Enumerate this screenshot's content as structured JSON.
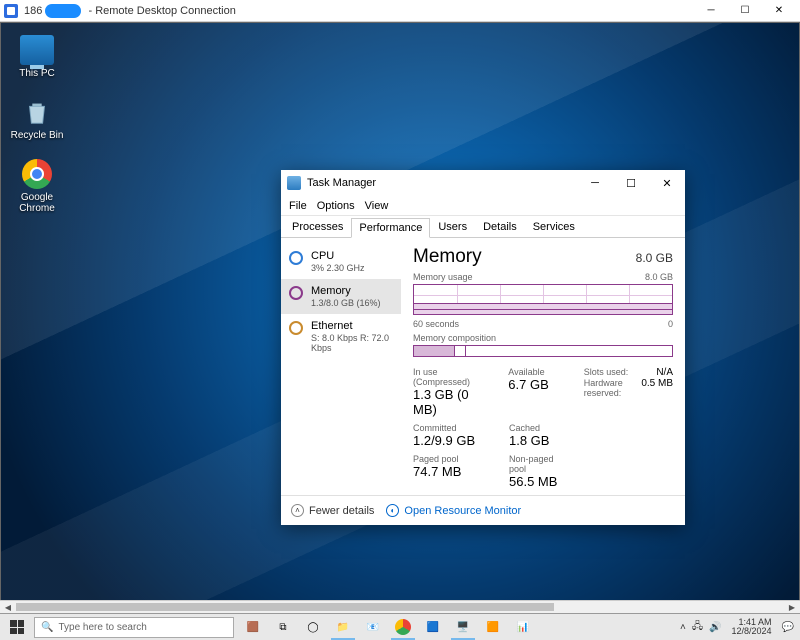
{
  "rdc": {
    "title_prefix": "186",
    "title_suffix": "- Remote Desktop Connection"
  },
  "desktop": {
    "this_pc": "This PC",
    "recycle": "Recycle Bin",
    "chrome": "Google Chrome"
  },
  "taskmgr": {
    "title": "Task Manager",
    "menu": {
      "file": "File",
      "options": "Options",
      "view": "View"
    },
    "tabs": {
      "processes": "Processes",
      "performance": "Performance",
      "users": "Users",
      "details": "Details",
      "services": "Services"
    },
    "side": {
      "cpu": {
        "name": "CPU",
        "sub": "3% 2.30 GHz"
      },
      "memory": {
        "name": "Memory",
        "sub": "1.3/8.0 GB (16%)"
      },
      "ethernet": {
        "name": "Ethernet",
        "sub": "S: 8.0 Kbps R: 72.0 Kbps"
      }
    },
    "right": {
      "heading": "Memory",
      "capacity": "8.0 GB",
      "usage_label": "Memory usage",
      "usage_max": "8.0 GB",
      "xaxis_left": "60 seconds",
      "xaxis_right": "0",
      "comp_label": "Memory composition",
      "stats": {
        "inuse_k": "In use (Compressed)",
        "inuse_v": "1.3 GB (0 MB)",
        "avail_k": "Available",
        "avail_v": "6.7 GB",
        "slots_k": "Slots used:",
        "slots_v": "N/A",
        "hwres_k": "Hardware reserved:",
        "hwres_v": "0.5 MB",
        "committed_k": "Committed",
        "committed_v": "1.2/9.9 GB",
        "cached_k": "Cached",
        "cached_v": "1.8 GB",
        "paged_k": "Paged pool",
        "paged_v": "74.7 MB",
        "nonpaged_k": "Non-paged pool",
        "nonpaged_v": "56.5 MB"
      }
    },
    "footer": {
      "fewer": "Fewer details",
      "resmon": "Open Resource Monitor"
    }
  },
  "host": {
    "search_placeholder": "Type here to search",
    "clock_time": "1:41 AM",
    "clock_date": "12/8/2024"
  }
}
